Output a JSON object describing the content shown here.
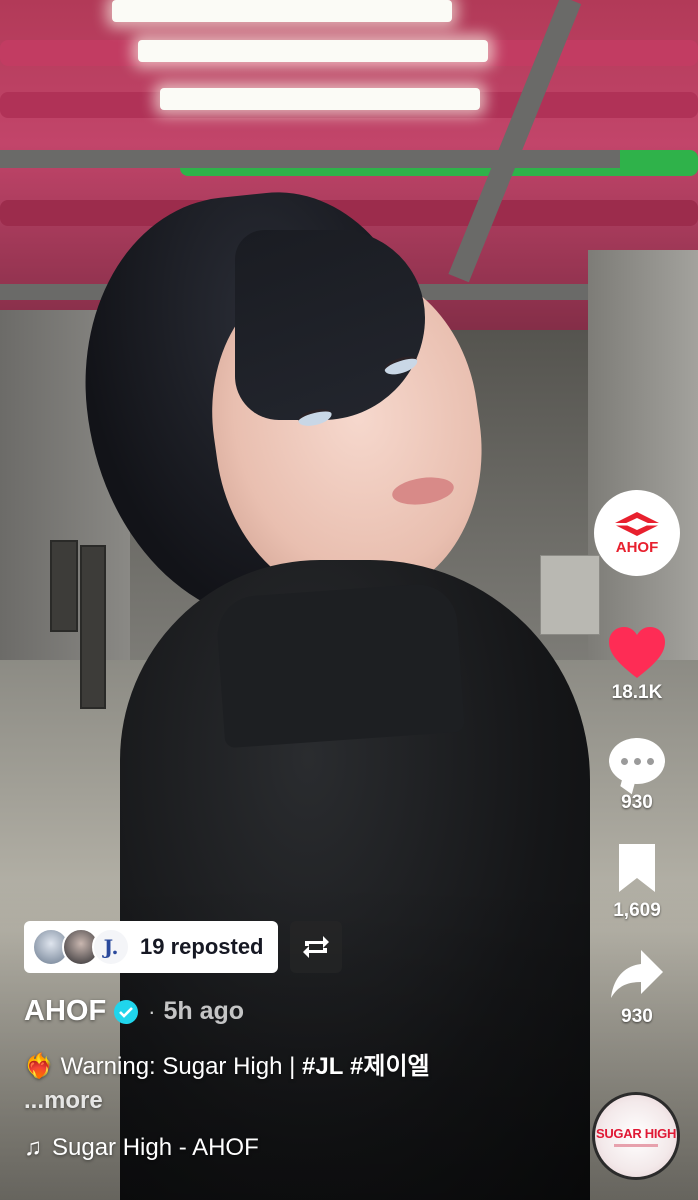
{
  "creator": {
    "name": "AHOF",
    "avatar_logo_text": "AHOF",
    "posted_ago": "5h ago",
    "verified": true
  },
  "actions": {
    "likes": "18.1K",
    "comments": "930",
    "saves": "1,609",
    "shares": "930"
  },
  "repost": {
    "text": "19 reposted",
    "avatar_initial": "J."
  },
  "caption": {
    "emoji": "❤️‍🔥",
    "text": "Warning: Sugar High | ",
    "tags": [
      "#JL",
      "#제이엘"
    ],
    "more": "...more"
  },
  "music": {
    "title": "Sugar High - AHOF",
    "disc_label": "SUGAR HIGH"
  },
  "colors": {
    "like_red": "#fe2c55",
    "verified_blue": "#20d5ec",
    "brand_red": "#e8202e"
  },
  "icons": [
    "heart-icon",
    "comment-icon",
    "bookmark-icon",
    "share-icon",
    "repost-icon",
    "verified-icon",
    "music-note-icon"
  ]
}
